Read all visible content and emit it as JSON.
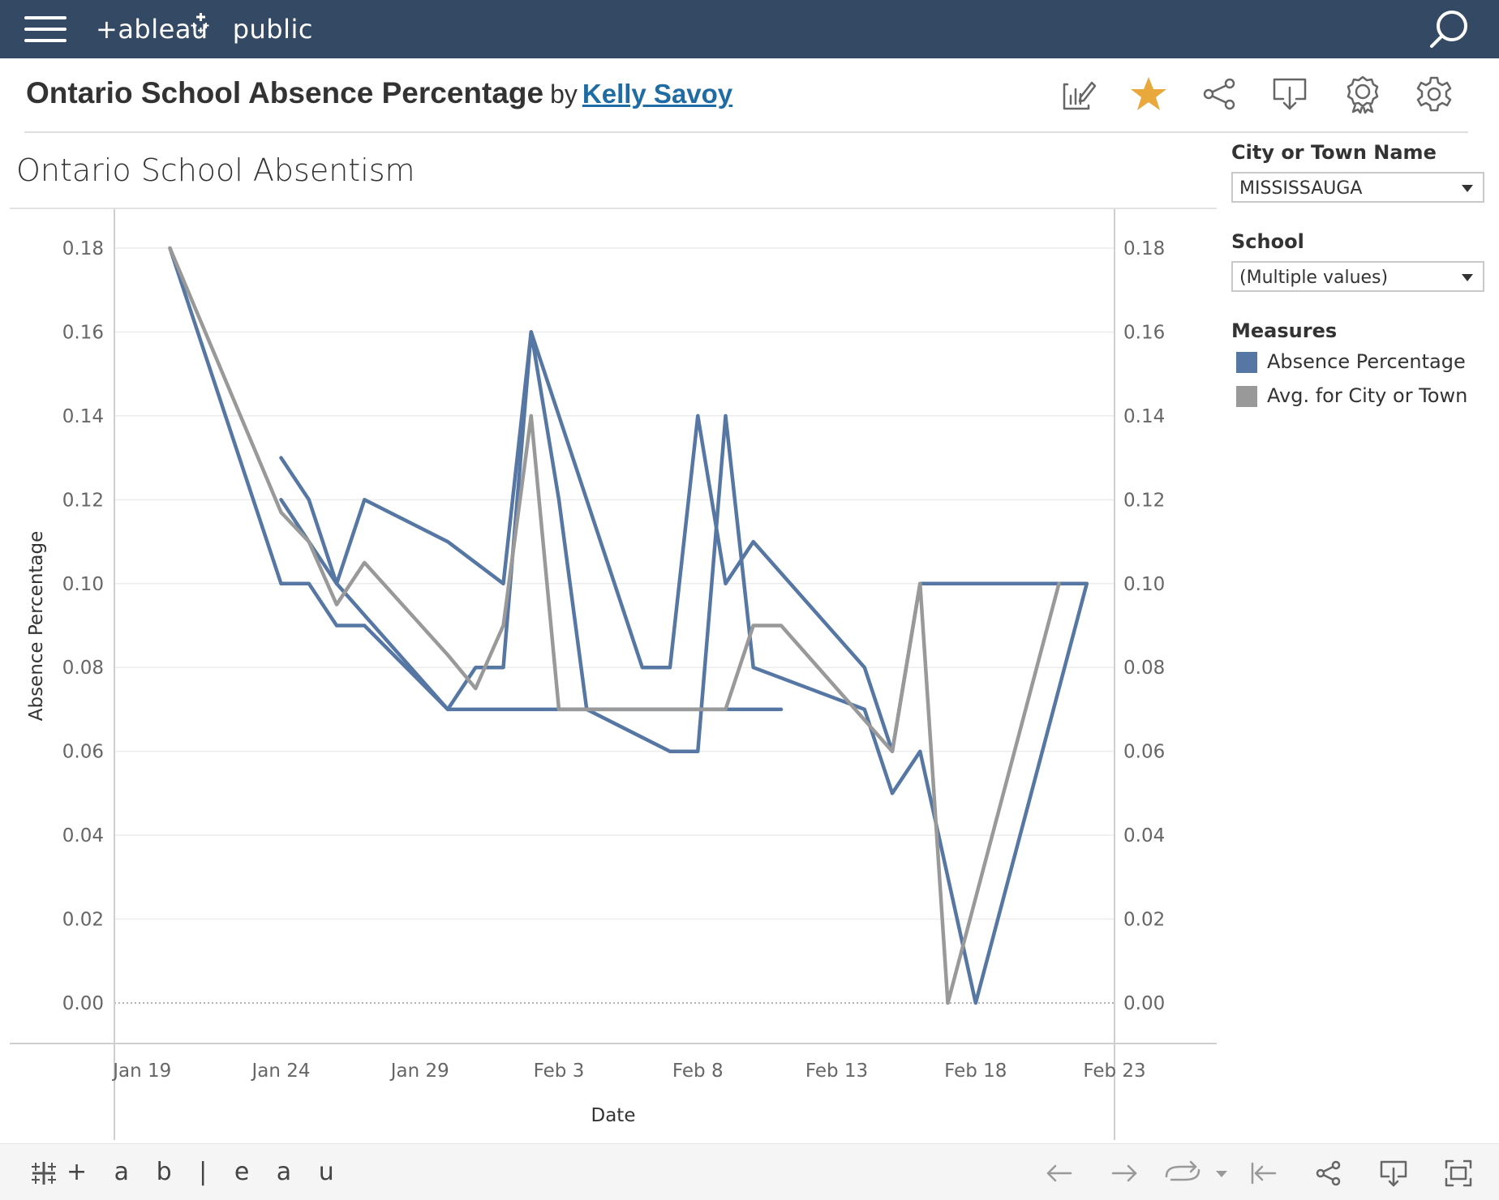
{
  "app": {
    "logo_text": "+ableau",
    "logo_suffix": "public",
    "footer_logo": "+ a b | e a u"
  },
  "header": {
    "title": "Ontario School Absence Percentage",
    "by": "by",
    "author": "Kelly Savoy"
  },
  "toolbar_icons": [
    "edit-viz-icon",
    "favorite-star-icon",
    "share-icon",
    "download-icon",
    "badge-icon",
    "settings-gear-icon"
  ],
  "dashboard": {
    "heading": "Ontario School Absentism"
  },
  "filters": {
    "city_label": "City or Town Name",
    "city_value": "MISSISSAUGA",
    "school_label": "School",
    "school_value": "(Multiple values)",
    "measures_label": "Measures",
    "measures": [
      {
        "name": "Absence Percentage",
        "color": "#5677a3"
      },
      {
        "name": "Avg. for City or Town",
        "color": "#999999"
      }
    ]
  },
  "colors": {
    "topbar": "#344a64",
    "star": "#e8a83c",
    "blue_series": "#5677a3",
    "gray_series": "#999999"
  },
  "chart_data": {
    "type": "line",
    "xlabel": "Date",
    "ylabel": "Absence Percentage",
    "ylim": [
      0,
      0.18
    ],
    "yticks": [
      "0.00",
      "0.02",
      "0.04",
      "0.06",
      "0.08",
      "0.10",
      "0.12",
      "0.14",
      "0.16",
      "0.18"
    ],
    "xlim": [
      "2020-01-18",
      "2020-02-23"
    ],
    "xticks": [
      {
        "date": "2020-01-19",
        "label": "Jan 19"
      },
      {
        "date": "2020-01-24",
        "label": "Jan 24"
      },
      {
        "date": "2020-01-29",
        "label": "Jan 29"
      },
      {
        "date": "2020-02-03",
        "label": "Feb 3"
      },
      {
        "date": "2020-02-08",
        "label": "Feb 8"
      },
      {
        "date": "2020-02-13",
        "label": "Feb 13"
      },
      {
        "date": "2020-02-18",
        "label": "Feb 18"
      },
      {
        "date": "2020-02-23",
        "label": "Feb 23"
      }
    ],
    "grid": true,
    "dual_axis": true,
    "series": [
      {
        "name": "Absence Percentage",
        "color": "#5677a3",
        "points": [
          [
            "2020-01-20",
            0.18
          ],
          [
            "2020-01-24",
            0.1
          ],
          [
            "2020-01-25",
            0.1
          ],
          [
            "2020-01-26",
            0.09
          ],
          [
            "2020-01-27",
            0.09
          ],
          [
            "2020-01-30",
            0.07
          ],
          [
            "2020-01-31",
            0.07
          ],
          [
            "2020-02-01",
            0.07
          ],
          [
            "2020-02-02",
            0.07
          ],
          [
            "2020-02-03",
            0.07
          ],
          [
            "2020-02-04",
            0.07
          ],
          [
            "2020-02-05",
            0.07
          ],
          [
            "2020-02-06",
            0.07
          ],
          [
            "2020-02-07",
            0.07
          ],
          [
            "2020-02-08",
            0.07
          ],
          [
            "2020-02-09",
            0.07
          ],
          [
            "2020-02-10",
            0.07
          ],
          [
            "2020-02-11",
            0.07
          ]
        ]
      },
      {
        "name": "Absence Percentage",
        "color": "#5677a3",
        "points": [
          [
            "2020-01-24",
            0.12
          ],
          [
            "2020-01-25",
            0.11
          ],
          [
            "2020-01-26",
            0.1
          ],
          [
            "2020-01-30",
            0.07
          ],
          [
            "2020-01-31",
            0.08
          ],
          [
            "2020-02-01",
            0.08
          ],
          [
            "2020-02-02",
            0.16
          ],
          [
            "2020-02-03",
            0.12
          ],
          [
            "2020-02-04",
            0.07
          ],
          [
            "2020-02-07",
            0.06
          ],
          [
            "2020-02-08",
            0.06
          ],
          [
            "2020-02-09",
            0.14
          ],
          [
            "2020-02-10",
            0.08
          ],
          [
            "2020-02-14",
            0.07
          ],
          [
            "2020-02-15",
            0.05
          ],
          [
            "2020-02-16",
            0.06
          ],
          [
            "2020-02-18",
            0.0
          ],
          [
            "2020-02-22",
            0.1
          ]
        ]
      },
      {
        "name": "Absence Percentage",
        "color": "#5677a3",
        "points": [
          [
            "2020-01-24",
            0.13
          ],
          [
            "2020-01-25",
            0.12
          ],
          [
            "2020-01-26",
            0.1
          ],
          [
            "2020-01-27",
            0.12
          ],
          [
            "2020-01-30",
            0.11
          ],
          [
            "2020-02-01",
            0.1
          ],
          [
            "2020-02-02",
            0.16
          ],
          [
            "2020-02-06",
            0.08
          ],
          [
            "2020-02-07",
            0.08
          ],
          [
            "2020-02-08",
            0.14
          ],
          [
            "2020-02-09",
            0.1
          ],
          [
            "2020-02-10",
            0.11
          ],
          [
            "2020-02-14",
            0.08
          ],
          [
            "2020-02-15",
            0.06
          ],
          [
            "2020-02-16",
            0.1
          ],
          [
            "2020-02-22",
            0.1
          ]
        ]
      },
      {
        "name": "Avg. for City or Town",
        "color": "#999999",
        "points": [
          [
            "2020-01-20",
            0.18
          ],
          [
            "2020-01-24",
            0.117
          ],
          [
            "2020-01-25",
            0.11
          ],
          [
            "2020-01-26",
            0.095
          ],
          [
            "2020-01-27",
            0.105
          ],
          [
            "2020-01-30",
            0.083
          ],
          [
            "2020-01-31",
            0.075
          ],
          [
            "2020-02-01",
            0.09
          ],
          [
            "2020-02-02",
            0.14
          ],
          [
            "2020-02-03",
            0.07
          ],
          [
            "2020-02-08",
            0.07
          ],
          [
            "2020-02-09",
            0.07
          ],
          [
            "2020-02-10",
            0.09
          ],
          [
            "2020-02-11",
            0.09
          ],
          [
            "2020-02-15",
            0.06
          ],
          [
            "2020-02-16",
            0.1
          ],
          [
            "2020-02-17",
            0.0
          ],
          [
            "2020-02-21",
            0.1
          ]
        ]
      }
    ]
  }
}
